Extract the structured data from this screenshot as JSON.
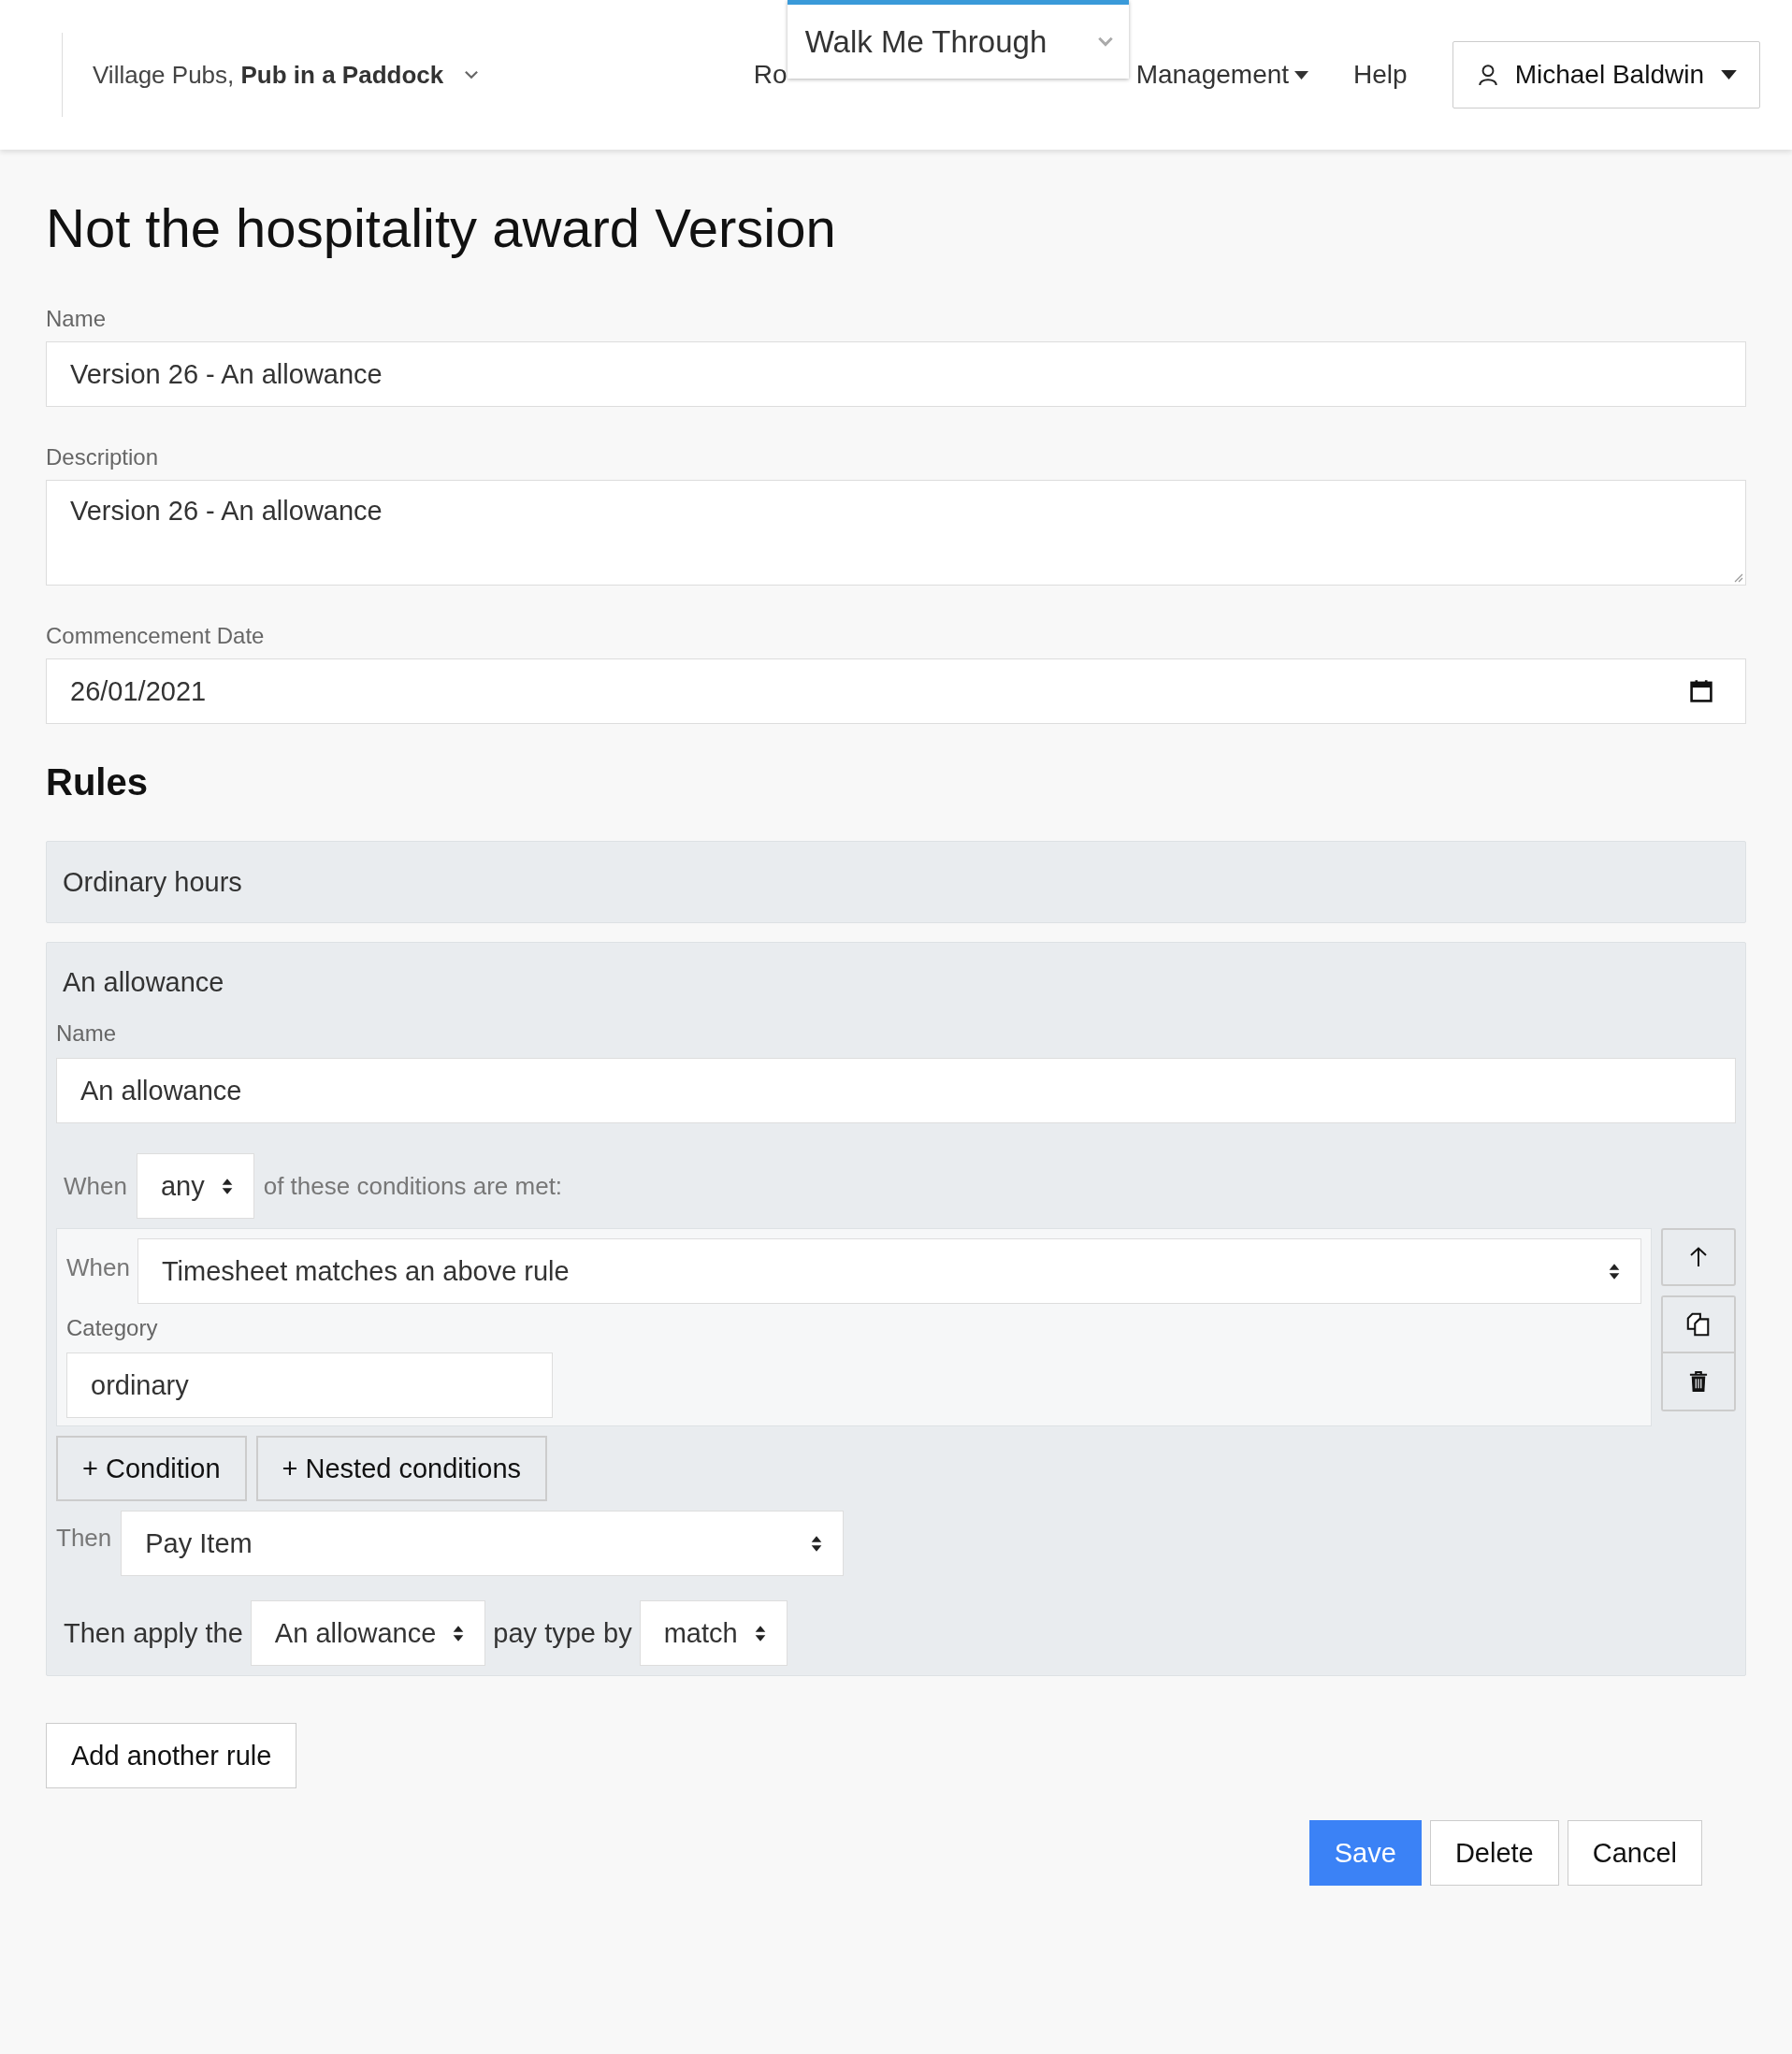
{
  "header": {
    "org_prefix": "Village Pubs,",
    "org_name": "Pub in a Paddock",
    "nav": [
      {
        "label": "Ro",
        "dropdown": false
      },
      {
        "label": "Management",
        "dropdown": true
      },
      {
        "label": "Help",
        "dropdown": false
      }
    ],
    "user": "Michael Baldwin"
  },
  "walkthrough": {
    "label": "Walk Me Through"
  },
  "title": "Not the hospitality award Version",
  "fields": [
    {
      "label": "Name",
      "value": "Version 26 - An allowance",
      "kind": "text"
    },
    {
      "label": "Description",
      "value": "Version 26 - An allowance",
      "kind": "textarea"
    },
    {
      "label": "Commencement Date",
      "value": "26/01/2021",
      "kind": "date"
    }
  ],
  "rules_heading": "Rules",
  "rules": [
    {
      "title": "Ordinary hours",
      "expanded": false
    },
    {
      "title": "An allowance",
      "expanded": true,
      "name_label": "Name",
      "name_value": "An allowance",
      "match": {
        "prefix": "When",
        "value": "any",
        "suffix": "of these conditions are met:"
      },
      "conditions": [
        {
          "when_label": "When",
          "when_value": "Timesheet matches an above rule",
          "category_label": "Category",
          "category_value": "ordinary"
        }
      ],
      "add_buttons": [
        "+ Condition",
        "+ Nested conditions"
      ],
      "then_label": "Then",
      "then_value": "Pay Item",
      "apply": {
        "prefix": "Then apply the",
        "pay_type": "An allowance",
        "middle": "pay type by",
        "method": "match"
      }
    }
  ],
  "add_rule": "Add another rule",
  "actions": [
    {
      "label": "Save",
      "kind": "primary"
    },
    {
      "label": "Delete",
      "kind": "default"
    },
    {
      "label": "Cancel",
      "kind": "default"
    }
  ]
}
